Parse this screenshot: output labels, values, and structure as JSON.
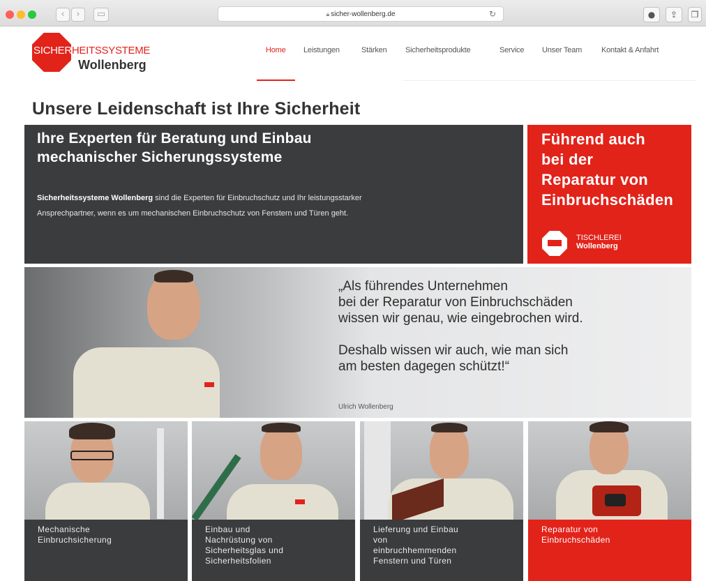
{
  "browser": {
    "url": "sicher-wollenberg.de",
    "back_icon": "chevron-left-icon",
    "forward_icon": "chevron-right-icon"
  },
  "logo": {
    "part1": "SICHER",
    "part2": "HEITSSYSTEME",
    "line2": "Wollenberg"
  },
  "nav": {
    "items": [
      "Home",
      "Leistungen",
      "Stärken",
      "Sicherheitsprodukte",
      "Service",
      "Unser Team",
      "Kontakt & Anfahrt"
    ],
    "active": "Home"
  },
  "headline": "Unsere Leidenschaft ist Ihre Sicherheit",
  "intro": {
    "heading_lines": [
      "Ihre Experten für Beratung und Einbau",
      "mechanischer Sicherungssysteme"
    ],
    "bold": "Sicherheitssysteme Wollenberg",
    "text_line1": " sind die Experten für Einbruchschutz und Ihr leistungsstarker",
    "text_line2": "Ansprechpartner, wenn es um mechanischen Einbruchschutz von Fenstern und Türen geht."
  },
  "promo": {
    "heading_lines": [
      "Führend auch",
      "bei der",
      "Reparatur von",
      "Einbruchschäden"
    ],
    "badge_line1": "TISCHLEREI",
    "badge_line2": "Wollenberg"
  },
  "quote": {
    "lines_a": [
      "„Als führendes Unternehmen",
      "bei der Reparatur von Einbruchschäden",
      "wissen wir genau, wie eingebrochen wird."
    ],
    "lines_b": [
      "Deshalb wissen wir auch, wie man sich",
      "am besten dagegen schützt!“"
    ],
    "author": "Ulrich Wollenberg"
  },
  "tiles": [
    {
      "lines": [
        "Mechanische",
        "Einbruchsicherung"
      ]
    },
    {
      "lines": [
        "Einbau und",
        "Nachrüstung von",
        "Sicherheitsglas und",
        "Sicherheitsfolien"
      ]
    },
    {
      "lines": [
        "Lieferung und Einbau",
        "von",
        "einbruchhemmenden",
        "Fenstern und Türen"
      ]
    },
    {
      "lines": [
        "Reparatur von",
        "Einbruchschäden"
      ]
    }
  ],
  "colors": {
    "accent": "#e2231a",
    "dark_panel": "#3b3c3e"
  }
}
